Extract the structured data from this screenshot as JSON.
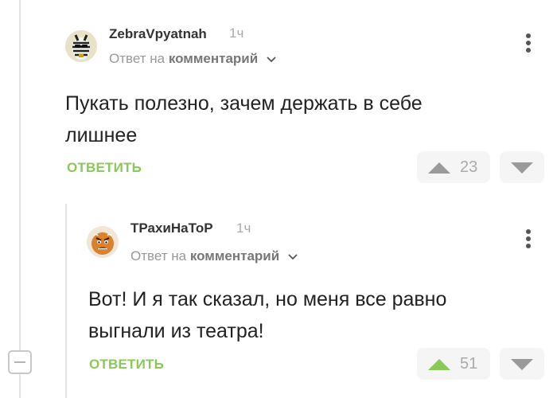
{
  "comments": [
    {
      "author": "ZebraVpyatnah",
      "time": "1ч",
      "reply_prefix": "Ответ на",
      "reply_target": "комментарий",
      "text": "Пукать полезно, зачем держать в себе лишнее",
      "reply_label": "ОТВЕТИТЬ",
      "votes": "23",
      "upvoted": false
    },
    {
      "author": "ТРахиНаТоР",
      "time": "1ч",
      "reply_prefix": "Ответ на",
      "reply_target": "комментарий",
      "text": "Вот! И я так сказал, но меня все равно выгнали из театра!",
      "reply_label": "ОТВЕТИТЬ",
      "votes": "51",
      "upvoted": true
    }
  ],
  "colors": {
    "accent_green": "#8ac858",
    "upvote_active": "#8ac858",
    "vote_inactive": "#9a9a9a"
  },
  "icons": [
    "zebra-avatar",
    "angry-gingerbread-avatar",
    "chevron-down-icon",
    "more-vertical-icon",
    "upvote-icon",
    "downvote-icon",
    "collapse-minus-icon"
  ]
}
